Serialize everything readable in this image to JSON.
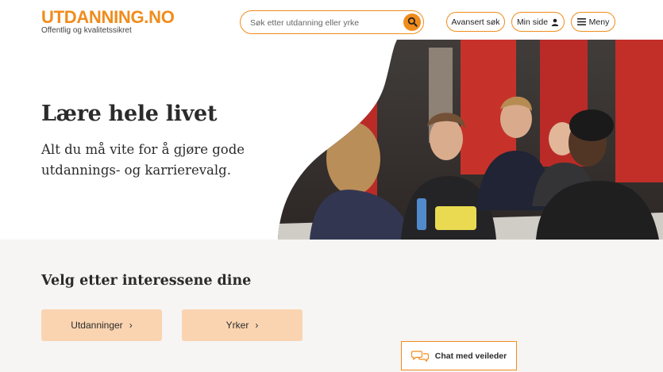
{
  "header": {
    "logo_title": "UTDANNING.NO",
    "logo_subtitle": "Offentlig og kvalitetssikret",
    "search_placeholder": "Søk etter utdanning eller yrke",
    "advanced_search_label": "Avansert søk",
    "my_page_label": "Min side",
    "menu_label": "Meny",
    "icons": {
      "search": "search-icon",
      "user": "user-icon",
      "menu": "hamburger-icon"
    }
  },
  "hero": {
    "title": "Lære hele livet",
    "subtitle": "Alt du må vite for å gjøre gode utdannings- og karrierevalg."
  },
  "interests": {
    "title": "Velg etter interessene dine",
    "buttons": [
      {
        "label": "Utdanninger",
        "chevron": "›"
      },
      {
        "label": "Yrker",
        "chevron": "›"
      }
    ]
  },
  "chat": {
    "label": "Chat med veileder",
    "icon": "chat-bubbles-icon"
  },
  "colors": {
    "brand_orange": "#f08c1c",
    "button_peach": "#fad4b1",
    "section_bg": "#f6f5f3",
    "text": "#2b2b2b"
  }
}
